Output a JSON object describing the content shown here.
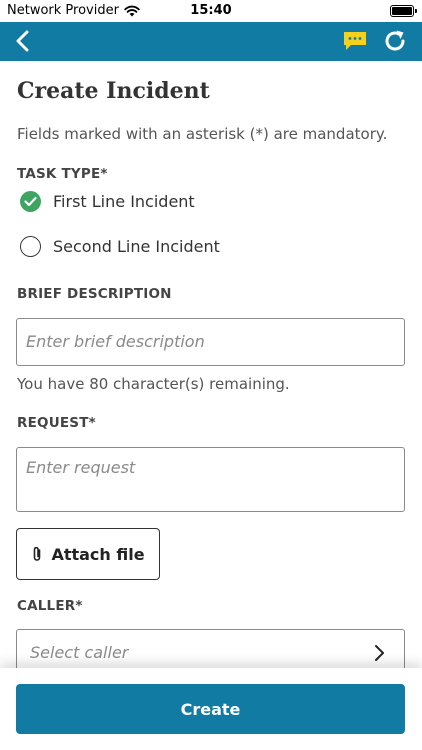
{
  "status_bar": {
    "carrier": "Network Provider",
    "time": "15:40"
  },
  "nav": {
    "icons": [
      "back-arrow-icon",
      "chat-bubble-icon",
      "refresh-icon"
    ],
    "accent_color": "#117ba3",
    "chat_icon_color": "#f2d21f"
  },
  "form": {
    "title": "Create Incident",
    "hint": "Fields marked with an asterisk (*) are mandatory.",
    "task_type": {
      "label": "TASK TYPE*",
      "options": [
        {
          "label": "First Line Incident",
          "selected": true
        },
        {
          "label": "Second Line Incident",
          "selected": false
        }
      ]
    },
    "brief_description": {
      "label": "BRIEF DESCRIPTION",
      "value": "",
      "placeholder": "Enter brief description",
      "remaining": "You have 80 character(s) remaining."
    },
    "request": {
      "label": "REQUEST*",
      "value": "",
      "placeholder": "Enter request"
    },
    "attach_label": "Attach file",
    "caller": {
      "label": "CALLER*",
      "placeholder": "Select caller"
    }
  },
  "footer": {
    "create_label": "Create"
  }
}
